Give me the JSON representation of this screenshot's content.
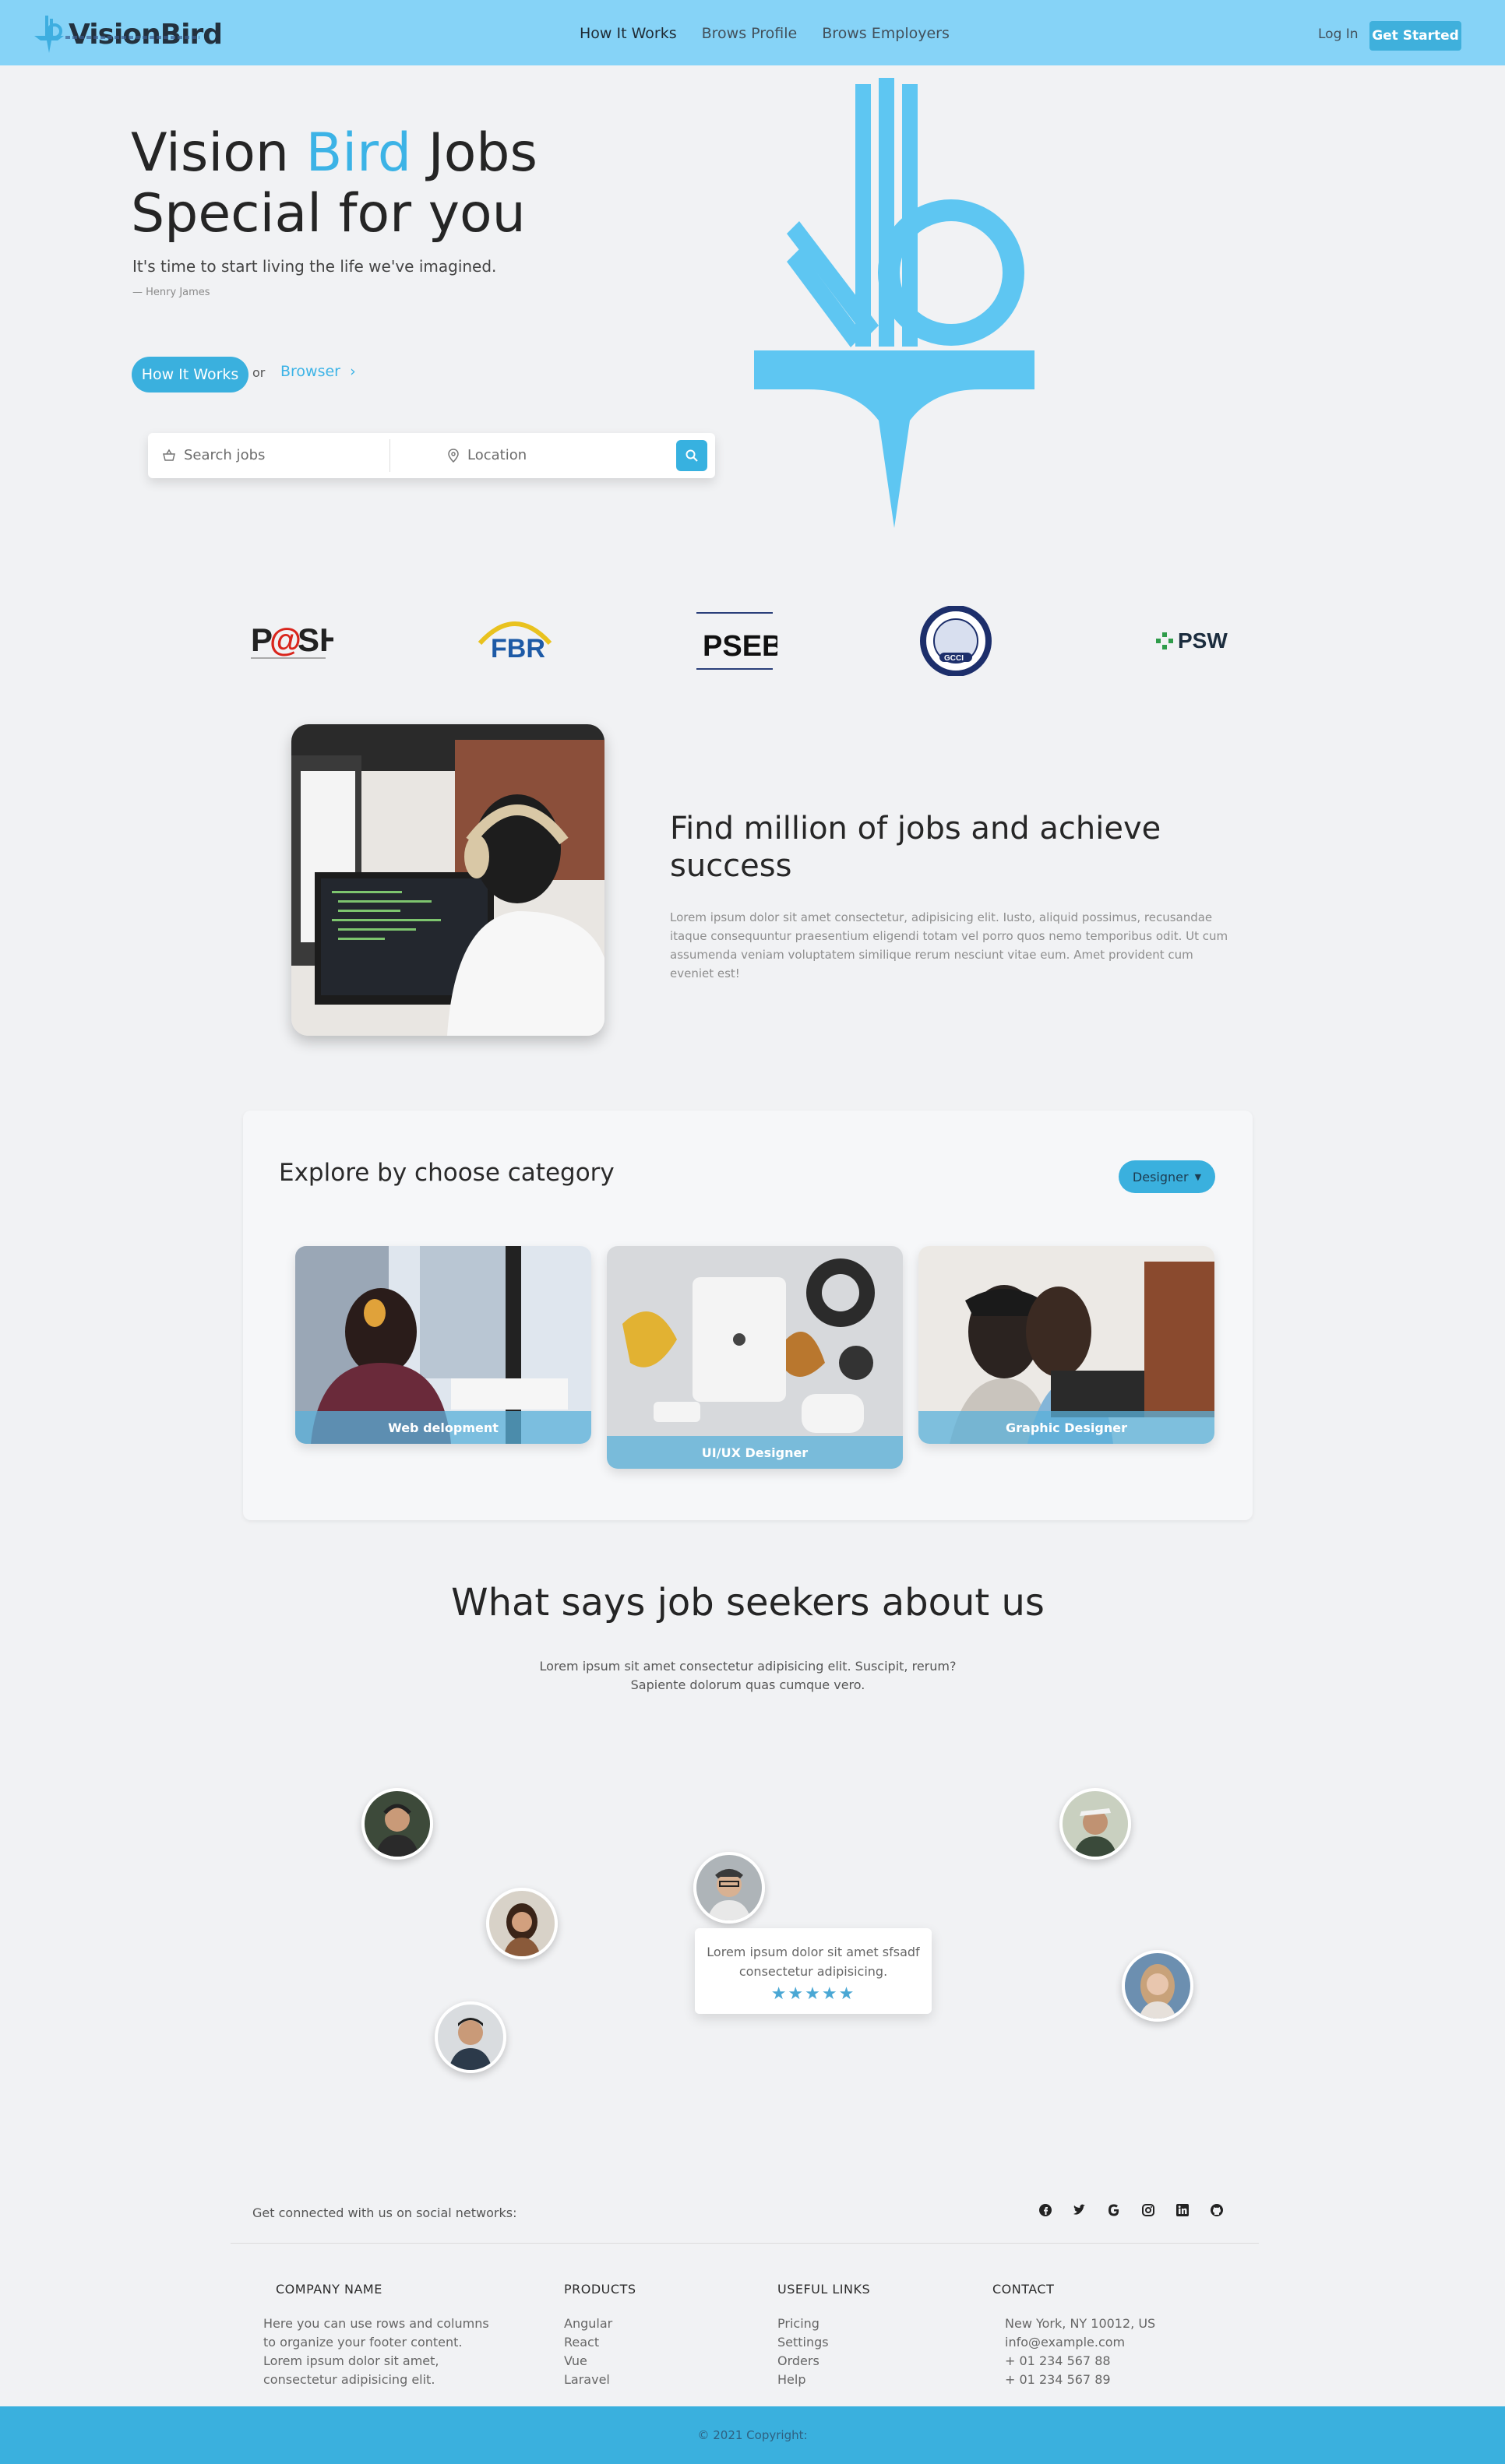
{
  "nav": {
    "brand": "VisionBird",
    "links": [
      "How It Works",
      "Brows Profile",
      "Brows Employers"
    ],
    "login": "Log In",
    "cta": "Get Started"
  },
  "hero": {
    "title_part1": "Vision ",
    "title_accent": "Bird",
    "title_part2": " Jobs",
    "title_line2": "Special for you",
    "subtitle": "It's time to start living the life we've imagined.",
    "author": "— Henry James",
    "how_button": "How It Works",
    "or": "or",
    "browser_link": "Browser",
    "search_placeholder": "Search jobs",
    "location_placeholder": "Location"
  },
  "partners": [
    "P@SHA",
    "FBR",
    "PSEB",
    "GCCI",
    "PSW"
  ],
  "feature": {
    "title": "Find million of jobs and achieve success",
    "text": "Lorem ipsum dolor sit amet consectetur, adipisicing elit. Iusto, aliquid possimus, recusandae itaque consequuntur praesentium eligendi totam vel porro quos nemo temporibus odit. Ut cum assumenda veniam voluptatem similique rerum nesciunt vitae eum. Amet provident cum eveniet est!"
  },
  "category": {
    "title": "Explore by choose category",
    "dropdown": "Designer",
    "cards": [
      "Web delopment",
      "UI/UX Designer",
      "Graphic Designer"
    ]
  },
  "testimonials": {
    "title": "What says job seekers about us",
    "subtitle_line1": "Lorem ipsum sit amet consectetur adipisicing elit. Suscipit, rerum?",
    "subtitle_line2": "Sapiente dolorum quas cumque vero.",
    "quote": "Lorem ipsum dolor sit amet sfsadf consectetur adipisicing.",
    "stars": "★★★★★"
  },
  "footer": {
    "social_text": "Get connected with us on social networks:",
    "social_icons": [
      "facebook-icon",
      "twitter-icon",
      "google-icon",
      "instagram-icon",
      "linkedin-icon",
      "github-icon"
    ],
    "company_title": "COMPANY NAME",
    "company_text": "Here you can use rows and columns to organize your footer content. Lorem ipsum dolor sit amet, consectetur adipisicing elit.",
    "products_title": "PRODUCTS",
    "products": [
      "Angular",
      "React",
      "Vue",
      "Laravel"
    ],
    "links_title": "USEFUL LINKS",
    "links": [
      "Pricing",
      "Settings",
      "Orders",
      "Help"
    ],
    "contact_title": "CONTACT",
    "contact": [
      "New York, NY 10012, US",
      "info@example.com",
      "+ 01 234 567 88",
      "+ 01 234 567 89"
    ],
    "copyright": "© 2021 Copyright:"
  },
  "colors": {
    "nav_bg": "#86d3f7",
    "accent": "#3ab0de",
    "logo_blue": "#5ec6f2",
    "page_bg": "#f1f2f4"
  }
}
